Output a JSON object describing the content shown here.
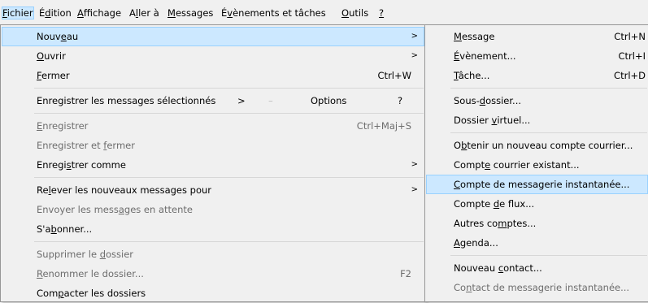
{
  "menubar": {
    "items": [
      "Fichier",
      "Édition",
      "Affichage",
      "Aller à",
      "Messages",
      "Évènements et tâches",
      "Outils",
      "?"
    ]
  },
  "file_menu": {
    "nouveau": "Nouveau",
    "ouvrir": "Ouvrir",
    "fermer": "Fermer",
    "fermer_shortcut": "Ctrl+W",
    "enreg_selection": "Enregistrer les messages sélectionnés",
    "enreg_selection_arrow": ">",
    "enreg_selection_dash": "–",
    "options": "Options",
    "help": "?",
    "enregistrer": "Enregistrer",
    "enregistrer_shortcut": "Ctrl+Maj+S",
    "enregistrer_fermer": "Enregistrer et fermer",
    "enregistrer_comme": "Enregistrer comme",
    "relever": "Relever les nouveaux messages pour",
    "envoyer": "Envoyer les messages en attente",
    "sabonner": "S'abonner...",
    "supprimer": "Supprimer le dossier",
    "renommer": "Renommer le dossier...",
    "renommer_shortcut": "F2",
    "compacter": "Compacter les dossiers"
  },
  "sub_menu": {
    "message": "Message",
    "message_shortcut": "Ctrl+N",
    "evenement": "Évènement...",
    "evenement_shortcut": "Ctrl+I",
    "tache": "Tâche...",
    "tache_shortcut": "Ctrl+D",
    "sous_dossier": "Sous-dossier...",
    "dossier_virtuel": "Dossier virtuel...",
    "obtenir": "Obtenir un nouveau compte courrier...",
    "compte_existant": "Compte courrier existant...",
    "compte_messagerie": "Compte de messagerie instantanée...",
    "compte_flux": "Compte de flux...",
    "autres": "Autres comptes...",
    "agenda": "Agenda...",
    "nouveau_contact": "Nouveau contact...",
    "contact_messagerie": "Contact de messagerie instantanée..."
  },
  "colors": {
    "menu_bg": "#f0f0f0",
    "highlight": "#cce8ff",
    "highlight_border": "#99d1ff",
    "disabled_text": "#6d6d6d"
  }
}
